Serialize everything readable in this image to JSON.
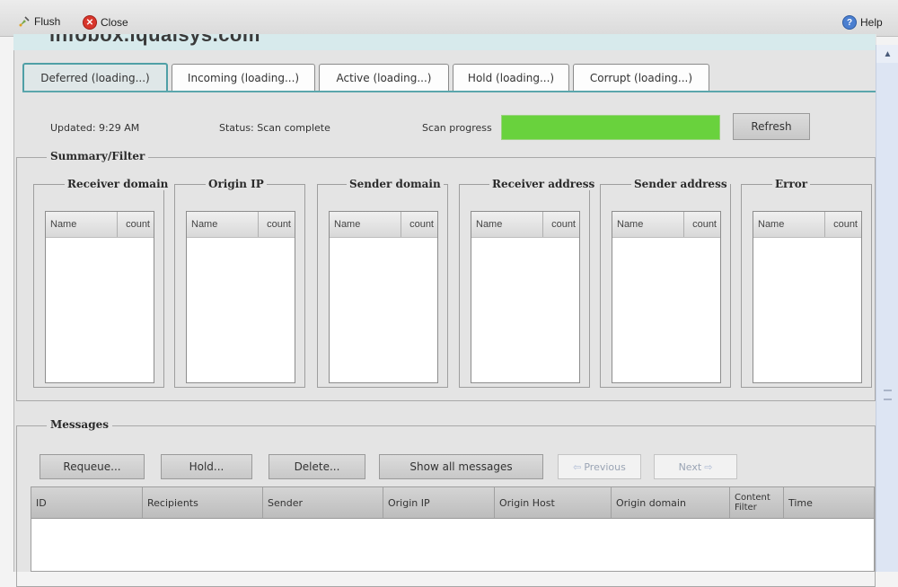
{
  "toolbar": {
    "flush": "Flush",
    "close": "Close",
    "help": "Help"
  },
  "header_cut_text": "infobox.iqualsys.com",
  "tabs": [
    {
      "label": "Deferred (loading...)",
      "active": true
    },
    {
      "label": "Incoming (loading...)",
      "active": false
    },
    {
      "label": "Active (loading...)",
      "active": false
    },
    {
      "label": "Hold (loading...)",
      "active": false
    },
    {
      "label": "Corrupt (loading...)",
      "active": false
    }
  ],
  "status": {
    "updated": "Updated:  9:29 AM",
    "status": "Status:  Scan complete",
    "progress_label": "Scan progress",
    "progress_value": 1.0,
    "progress_color": "#69d23d",
    "refresh": "Refresh"
  },
  "summary": {
    "legend": "Summary/Filter",
    "columns": [
      {
        "title": "Receiver domain"
      },
      {
        "title": "Origin IP"
      },
      {
        "title": "Sender domain"
      },
      {
        "title": "Receiver address"
      },
      {
        "title": "Sender address"
      },
      {
        "title": "Error"
      }
    ],
    "name_header": "Name",
    "count_header": "count"
  },
  "messages": {
    "legend": "Messages",
    "buttons": {
      "requeue": "Requeue...",
      "hold": "Hold...",
      "delete": "Delete...",
      "show_all": "Show all messages",
      "previous": "Previous",
      "next": "Next"
    },
    "columns": [
      "ID",
      "Recipients",
      "Sender",
      "Origin IP",
      "Origin Host",
      "Origin domain",
      "Content Filter",
      "Time"
    ]
  },
  "colors": {
    "tab_accent": "#5ba6ac",
    "header_band": "#d7eaec"
  }
}
